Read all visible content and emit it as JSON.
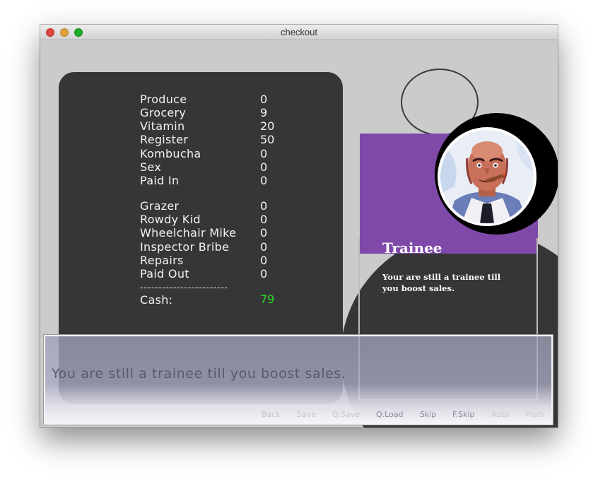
{
  "window": {
    "title": "checkout"
  },
  "ledger": {
    "income": [
      {
        "label": "Produce",
        "value": "0"
      },
      {
        "label": "Grocery",
        "value": "9"
      },
      {
        "label": "Vitamin",
        "value": "20"
      },
      {
        "label": "Register",
        "value": "50"
      },
      {
        "label": "Kombucha",
        "value": "0"
      },
      {
        "label": "Sex",
        "value": "0"
      },
      {
        "label": "Paid In",
        "value": "0"
      }
    ],
    "expenses": [
      {
        "label": "Grazer",
        "value": "0"
      },
      {
        "label": "Rowdy Kid",
        "value": "0"
      },
      {
        "label": "Wheelchair Mike",
        "value": "0"
      },
      {
        "label": "Inspector Bribe",
        "value": "0"
      },
      {
        "label": "Repairs",
        "value": "0"
      },
      {
        "label": "Paid Out",
        "value": "0"
      }
    ],
    "separator": "------------------------",
    "cash_label": "Cash:",
    "cash_value": "79"
  },
  "rank_card": {
    "title": "Trainee",
    "description": "Your are still a trainee till you boost sales."
  },
  "dialogue": {
    "text": "You are still a trainee till you boost sales."
  },
  "quick_menu": [
    {
      "label": "Back",
      "active": false
    },
    {
      "label": "Save",
      "active": false
    },
    {
      "label": "Q.Save",
      "active": false
    },
    {
      "label": "Q.Load",
      "active": true
    },
    {
      "label": "Skip",
      "active": true
    },
    {
      "label": "F.Skip",
      "active": true
    },
    {
      "label": "Auto",
      "active": false
    },
    {
      "label": "Prefs",
      "active": false
    }
  ],
  "colors": {
    "panel": "#363636",
    "card_purple": "#7e49a8",
    "cash_green": "#22e022"
  }
}
